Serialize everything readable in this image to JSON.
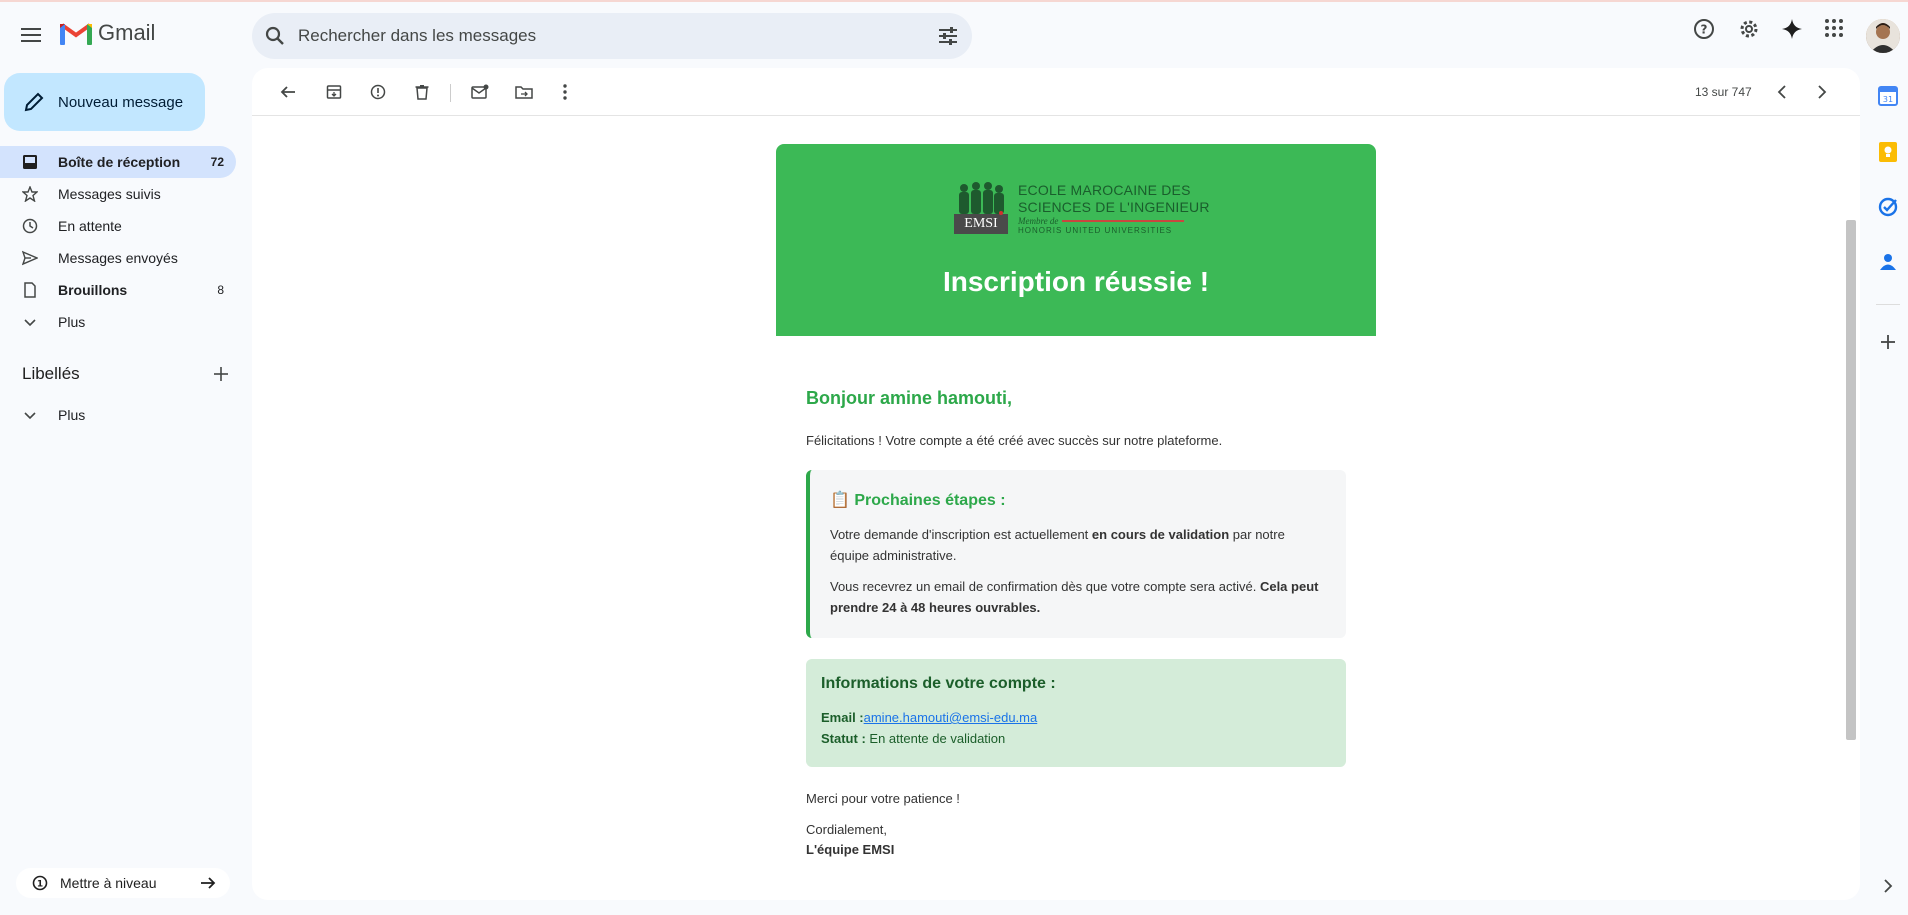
{
  "app": {
    "name": "Gmail"
  },
  "search": {
    "placeholder": "Rechercher dans les messages"
  },
  "compose": {
    "label": "Nouveau message"
  },
  "nav": [
    {
      "label": "Boîte de réception",
      "count": "72",
      "icon": "inbox-icon"
    },
    {
      "label": "Messages suivis",
      "count": "",
      "icon": "star-icon"
    },
    {
      "label": "En attente",
      "count": "",
      "icon": "clock-icon"
    },
    {
      "label": "Messages envoyés",
      "count": "",
      "icon": "send-icon"
    },
    {
      "label": "Brouillons",
      "count": "8",
      "icon": "draft-icon"
    },
    {
      "label": "Plus",
      "count": "",
      "icon": "chevron-down-icon"
    }
  ],
  "labels": {
    "title": "Libellés",
    "more": "Plus"
  },
  "upgrade": {
    "label": "Mettre à niveau"
  },
  "toolbar": {
    "pager": "13 sur 747"
  },
  "email": {
    "org_line1": "ECOLE MAROCAINE DES",
    "org_line2": "SCIENCES DE L'INGENIEUR",
    "org_member": "Membre de",
    "org_network": "HONORIS UNITED UNIVERSITIES",
    "org_abbr": "EMSI",
    "headline": "Inscription réussie !",
    "greeting": "Bonjour amine hamouti,",
    "intro": "Félicitations ! Votre compte a été créé avec succès sur notre plateforme.",
    "steps_title": "📋 Prochaines étapes :",
    "steps_p1_a": "Votre demande d'inscription est actuellement ",
    "steps_p1_b": "en cours de validation",
    "steps_p1_c": " par notre équipe administrative.",
    "steps_p2_a": "Vous recevrez un email de confirmation dès que votre compte sera activé. ",
    "steps_p2_b": "Cela peut prendre 24 à 48 heures ouvrables.",
    "info_title": "Informations de votre compte :",
    "info_email_label": "Email :",
    "info_email": "amine.hamouti@emsi-edu.ma",
    "info_status_label": "Statut :",
    "info_status": " En attente de validation",
    "thanks": "Merci pour votre patience !",
    "closing": "Cordialement,",
    "team": "L'équipe EMSI"
  },
  "colors": {
    "banner": "#3cb956",
    "accent": "#2da84a",
    "compose": "#c2e7ff",
    "active_nav": "#d3e3fd"
  }
}
